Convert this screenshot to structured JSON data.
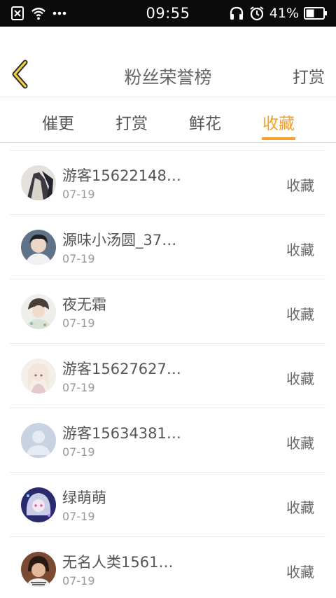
{
  "status_bar": {
    "time": "09:55",
    "battery": "41%",
    "icons_left": [
      "sim-off-icon",
      "wifi-icon",
      "more-dots-icon"
    ],
    "icons_right": [
      "headphones-icon",
      "alarm-icon",
      "battery-icon"
    ]
  },
  "header": {
    "title": "粉丝荣誉榜",
    "action_label": "打赏"
  },
  "tabs": [
    {
      "label": "催更",
      "active": false
    },
    {
      "label": "打赏",
      "active": false
    },
    {
      "label": "鲜花",
      "active": false
    },
    {
      "label": "收藏",
      "active": true
    }
  ],
  "colors": {
    "accent": "#f2a22c",
    "status_bar": "#0b0b0b"
  },
  "list": [
    {
      "name": "游客15622148…",
      "date": "07-19",
      "type": "收藏"
    },
    {
      "name": "源味小汤圆_37…",
      "date": "07-19",
      "type": "收藏"
    },
    {
      "name": "夜无霜",
      "date": "07-19",
      "type": "收藏"
    },
    {
      "name": "游客15627627…",
      "date": "07-19",
      "type": "收藏"
    },
    {
      "name": "游客15634381…",
      "date": "07-19",
      "type": "收藏"
    },
    {
      "name": "绿萌萌",
      "date": "07-19",
      "type": "收藏"
    },
    {
      "name": "无名人类1561…",
      "date": "07-19",
      "type": "收藏"
    }
  ]
}
